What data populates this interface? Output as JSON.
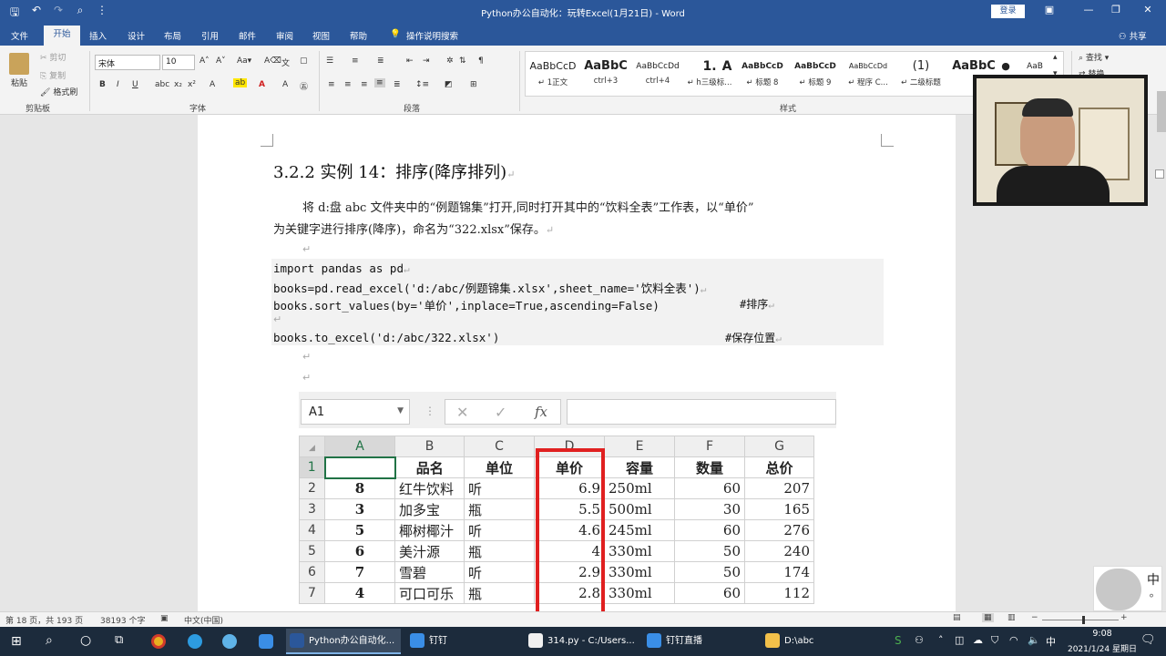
{
  "titlebar": {
    "doc_title": "Python办公自动化：玩转Excel(1月21日) - Word",
    "login": "登录",
    "qat": [
      "save-icon",
      "undo-icon",
      "redo-icon",
      "print-preview-icon",
      "customize-icon"
    ]
  },
  "ribbon_tabs": [
    "文件",
    "开始",
    "插入",
    "设计",
    "布局",
    "引用",
    "邮件",
    "审阅",
    "视图",
    "帮助",
    "操作说明搜索",
    "共享"
  ],
  "ribbon": {
    "clipboard": {
      "paste": "粘贴",
      "cut": "剪切",
      "copy": "复制",
      "format_painter": "格式刷",
      "label": "剪贴板"
    },
    "font": {
      "name": "宋体",
      "size": "10",
      "label": "字体"
    },
    "paragraph": {
      "label": "段落"
    },
    "styles": {
      "label": "样式",
      "items": [
        {
          "preview": "AaBbCcD",
          "name": "↵ 1正文"
        },
        {
          "preview": "AaBbC",
          "name": "ctrl+3"
        },
        {
          "preview": "AaBbCcDd",
          "name": "ctrl+4"
        },
        {
          "preview": "1.",
          "name": "↵ h三级标..."
        },
        {
          "preview": "A",
          "name": ""
        },
        {
          "preview": "AaBbCcD",
          "name": "↵ 标题 8"
        },
        {
          "preview": "AaBbCcD",
          "name": "↵ 标题 9"
        },
        {
          "preview": "AaBbCcDd",
          "name": "↵ 程序 C..."
        },
        {
          "preview": "(1)",
          "name": "↵ 二级标题"
        },
        {
          "preview": "AaBbC",
          "name": ""
        },
        {
          "preview": "●",
          "name": ""
        },
        {
          "preview": "AaB",
          "name": ""
        }
      ]
    },
    "editing": {
      "find": "查找",
      "replace": "替换"
    }
  },
  "document": {
    "heading": "3.2.2 实例 14：排序(降序排列)",
    "para1": "将 d:盘 abc 文件夹中的“例题锦集”打开,同时打开其中的“饮料全表”工作表，以“单价”",
    "para2": "为关键字进行排序(降序)，命名为“322.xlsx”保存。",
    "code": [
      "import pandas as pd",
      "books=pd.read_excel('d:/abc/例题锦集.xlsx',sheet_name='饮料全表')",
      "books.sort_values(by='单价',inplace=True,ascending=False)",
      "",
      "books.to_excel('d:/abc/322.xlsx')"
    ],
    "comment_sort": "#排序",
    "comment_save": "#保存位置",
    "pilcrow": "↵"
  },
  "excel": {
    "namebox": "A1",
    "fx": "fx",
    "cancel": "✕",
    "enter": "✓",
    "columns": [
      "A",
      "B",
      "C",
      "D",
      "E",
      "F",
      "G"
    ],
    "header": [
      "",
      "品名",
      "单位",
      "单价",
      "容量",
      "数量",
      "总价"
    ],
    "rows": [
      {
        "r": "2",
        "a": "8",
        "b": "红牛饮料",
        "c": "听",
        "d": "6.9",
        "e": "250ml",
        "f": "60",
        "g": "207"
      },
      {
        "r": "3",
        "a": "3",
        "b": "加多宝",
        "c": "瓶",
        "d": "5.5",
        "e": "500ml",
        "f": "30",
        "g": "165"
      },
      {
        "r": "4",
        "a": "5",
        "b": "椰树椰汁",
        "c": "听",
        "d": "4.6",
        "e": "245ml",
        "f": "60",
        "g": "276"
      },
      {
        "r": "5",
        "a": "6",
        "b": "美汁源",
        "c": "瓶",
        "d": "4",
        "e": "330ml",
        "f": "50",
        "g": "240"
      },
      {
        "r": "6",
        "a": "7",
        "b": "雪碧",
        "c": "听",
        "d": "2.9",
        "e": "330ml",
        "f": "50",
        "g": "174"
      },
      {
        "r": "7",
        "a": "4",
        "b": "可口可乐",
        "c": "瓶",
        "d": "2.8",
        "e": "330ml",
        "f": "60",
        "g": "112"
      }
    ]
  },
  "status": {
    "page": "第 18 页，共 193 页",
    "words": "38193 个字",
    "lang": "中文(中国)"
  },
  "ime": {
    "mode": "中"
  },
  "taskbar": {
    "apps": [
      "Python办公自动化...",
      "钉钉",
      "314.py - C:/Users...",
      "钉钉直播",
      "D:\\abc"
    ],
    "time": "9:08",
    "date": "2021/1/24 星期日"
  }
}
